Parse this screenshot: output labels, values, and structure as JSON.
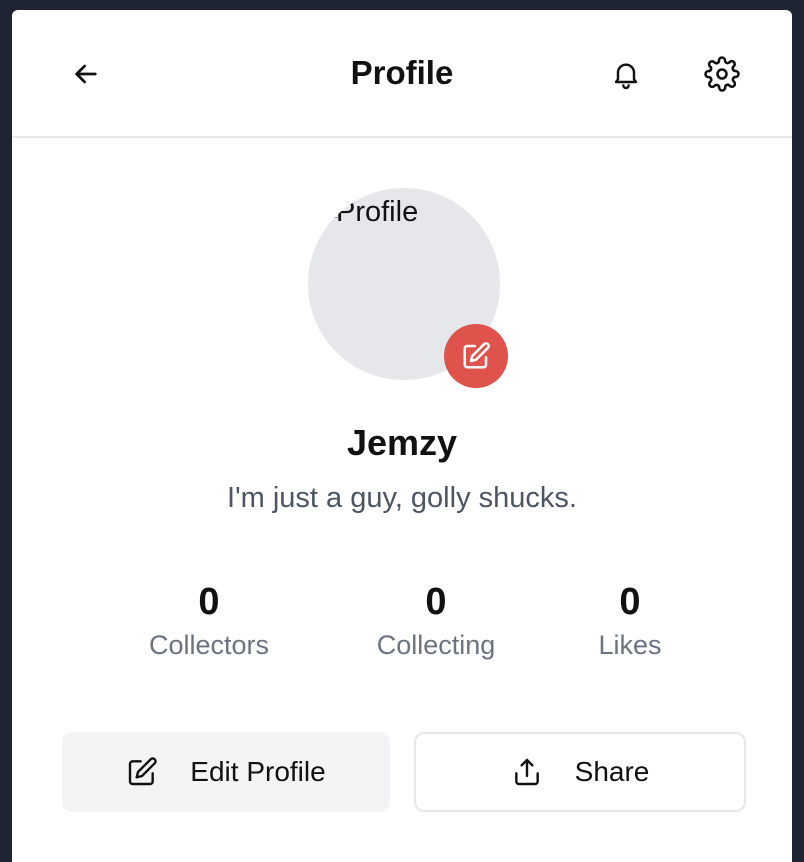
{
  "header": {
    "title": "Profile"
  },
  "avatar": {
    "alt_text": "Profile"
  },
  "profile": {
    "name": "Jemzy",
    "bio": "I'm just a guy, golly shucks."
  },
  "stats": [
    {
      "value": "0",
      "label": "Collectors"
    },
    {
      "value": "0",
      "label": "Collecting"
    },
    {
      "value": "0",
      "label": "Likes"
    }
  ],
  "actions": {
    "edit_label": "Edit Profile",
    "share_label": "Share"
  },
  "colors": {
    "accent": "#e0524c",
    "avatar_bg": "#e5e7eb",
    "muted_text": "#6b7280"
  },
  "icons": {
    "back": "arrow-left-icon",
    "notifications": "bell-icon",
    "settings": "gear-icon",
    "avatar_edit": "pencil-square-icon",
    "edit": "pencil-square-icon",
    "share": "share-upload-icon"
  }
}
